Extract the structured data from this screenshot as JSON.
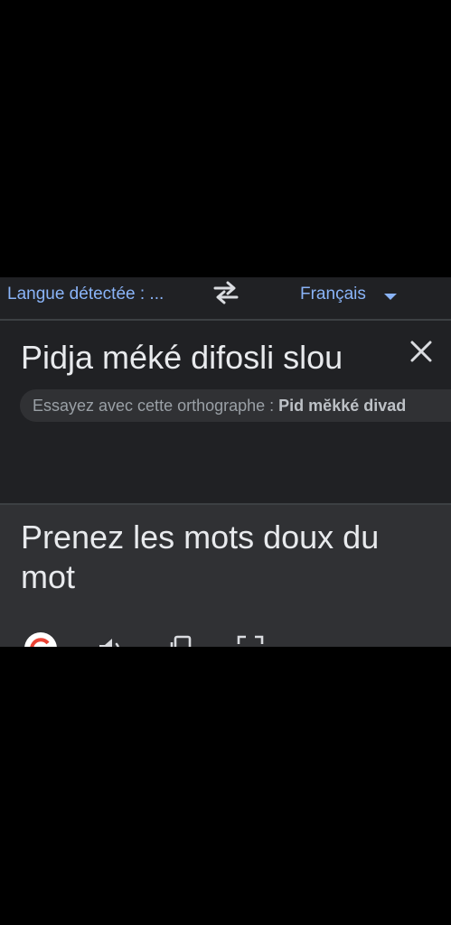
{
  "lang_bar": {
    "source_language": "Langue détectée : ...",
    "target_language": "Français"
  },
  "source": {
    "text": "Pidja méké difosli slou",
    "suggestion_label": "Essayez avec cette orthographe :",
    "suggestion_text": "Pid mĕkké divad"
  },
  "translation": {
    "text": "Prenez les mots doux du mot"
  },
  "icons": {
    "swap": "swap-arrows-icon",
    "dropdown": "caret-down-icon",
    "clear": "close-icon",
    "listen_source": "speaker-icon",
    "voice_input": "microphone-icon",
    "camera": "camera-icon",
    "google": "google-logo",
    "listen_translation": "speaker-icon",
    "copy": "copy-icon",
    "fullscreen": "fullscreen-icon"
  },
  "colors": {
    "accent": "#8ab4f8",
    "text": "#e8eaed",
    "muted": "#9aa0a6",
    "panel": "#202124",
    "result_panel": "#303134"
  }
}
